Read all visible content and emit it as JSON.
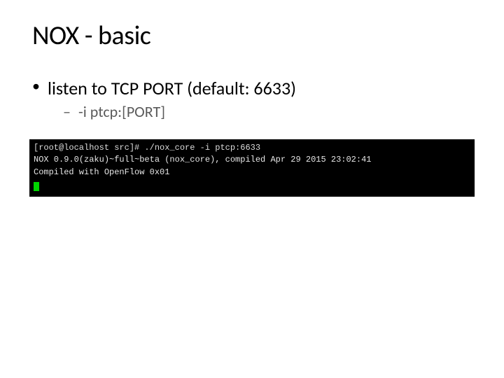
{
  "title": "NOX - basic",
  "bullets": {
    "l1": "listen to TCP PORT (default: 6633)",
    "l2": "-i ptcp:[PORT]"
  },
  "terminal": {
    "line1": "[root@localhost src]# ./nox_core -i ptcp:6633",
    "line2": "NOX 0.9.0(zaku)~full~beta (nox_core), compiled Apr 29 2015 23:02:41",
    "line3": "Compiled with OpenFlow 0x01"
  }
}
